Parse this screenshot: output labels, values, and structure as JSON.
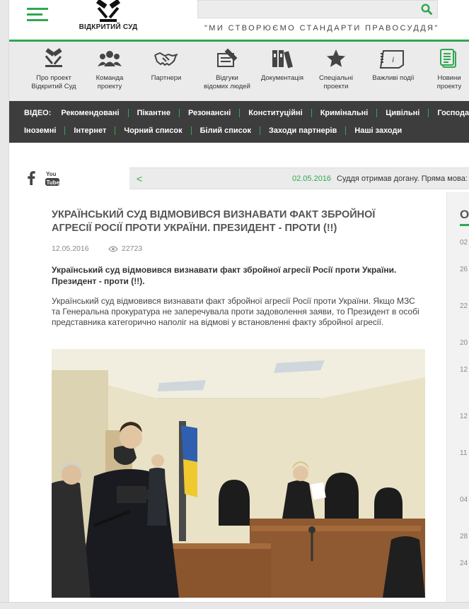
{
  "header": {
    "logo_text": "ВІДКРИТИЙ СУД",
    "search_placeholder": "",
    "slogan": "\"МИ СТВОРЮЄМО СТАНДАРТИ ПРАВОСУДДЯ\"",
    "accent_color": "#2fa84f"
  },
  "icon_nav": [
    {
      "icon": "gavel-icon",
      "line1": "Про проект",
      "line2": "Відкритий Суд"
    },
    {
      "icon": "team-icon",
      "line1": "Команда",
      "line2": "проекту"
    },
    {
      "icon": "handshake-icon",
      "line1": "Партнери",
      "line2": ""
    },
    {
      "icon": "review-icon",
      "line1": "Відгуки",
      "line2": "відомих людей"
    },
    {
      "icon": "documents-icon",
      "line1": "Документація",
      "line2": ""
    },
    {
      "icon": "star-icon",
      "line1": "Спеціальні",
      "line2": "проекти"
    },
    {
      "icon": "calendar-icon",
      "line1": "Важливі події",
      "line2": ""
    },
    {
      "icon": "news-icon",
      "line1": "Новини",
      "line2": "проекту"
    }
  ],
  "video_nav": {
    "label": "ВІДЕО:",
    "row1": [
      "Рекомендовані",
      "Пікантне",
      "Резонансні",
      "Конституційні",
      "Кримінальні",
      "Цивільні",
      "Господарські"
    ],
    "row2": [
      "Іноземні",
      "Інтернет",
      "Чорний список",
      "Білий список",
      "Заходи партнерів",
      "Наші заходи"
    ]
  },
  "social": {
    "facebook": "f",
    "youtube_line1": "You",
    "youtube_line2": "Tube"
  },
  "ticker": {
    "arrow": "<",
    "date": "02.05.2016",
    "text": "Суддя отримав догану. Пряма мова: \"Я вважаю, що відбулось порушення"
  },
  "article": {
    "title": "Український суд відмовився визнавати факт збройної агресії Росії проти України. Президент - проти (!!)",
    "date": "12.05.2016",
    "views": "22723",
    "lead": "Український суд відмовився визнавати факт збройної агресії Росії проти України. Президент - проти (!!).",
    "body": "Український суд відмовився визнавати факт збройної агресії Росії проти України. Якщо МЗС та Генеральна прокуратура не заперечувала проти задоволення заяви, то Президент в особі представника категорично наполіг на відмові у встановленні факту збройної агресії."
  },
  "sidebar": {
    "heading": "О",
    "dates": [
      "02",
      "26",
      "22",
      "20",
      "12",
      "12",
      "11",
      "04",
      "28",
      "24"
    ]
  }
}
